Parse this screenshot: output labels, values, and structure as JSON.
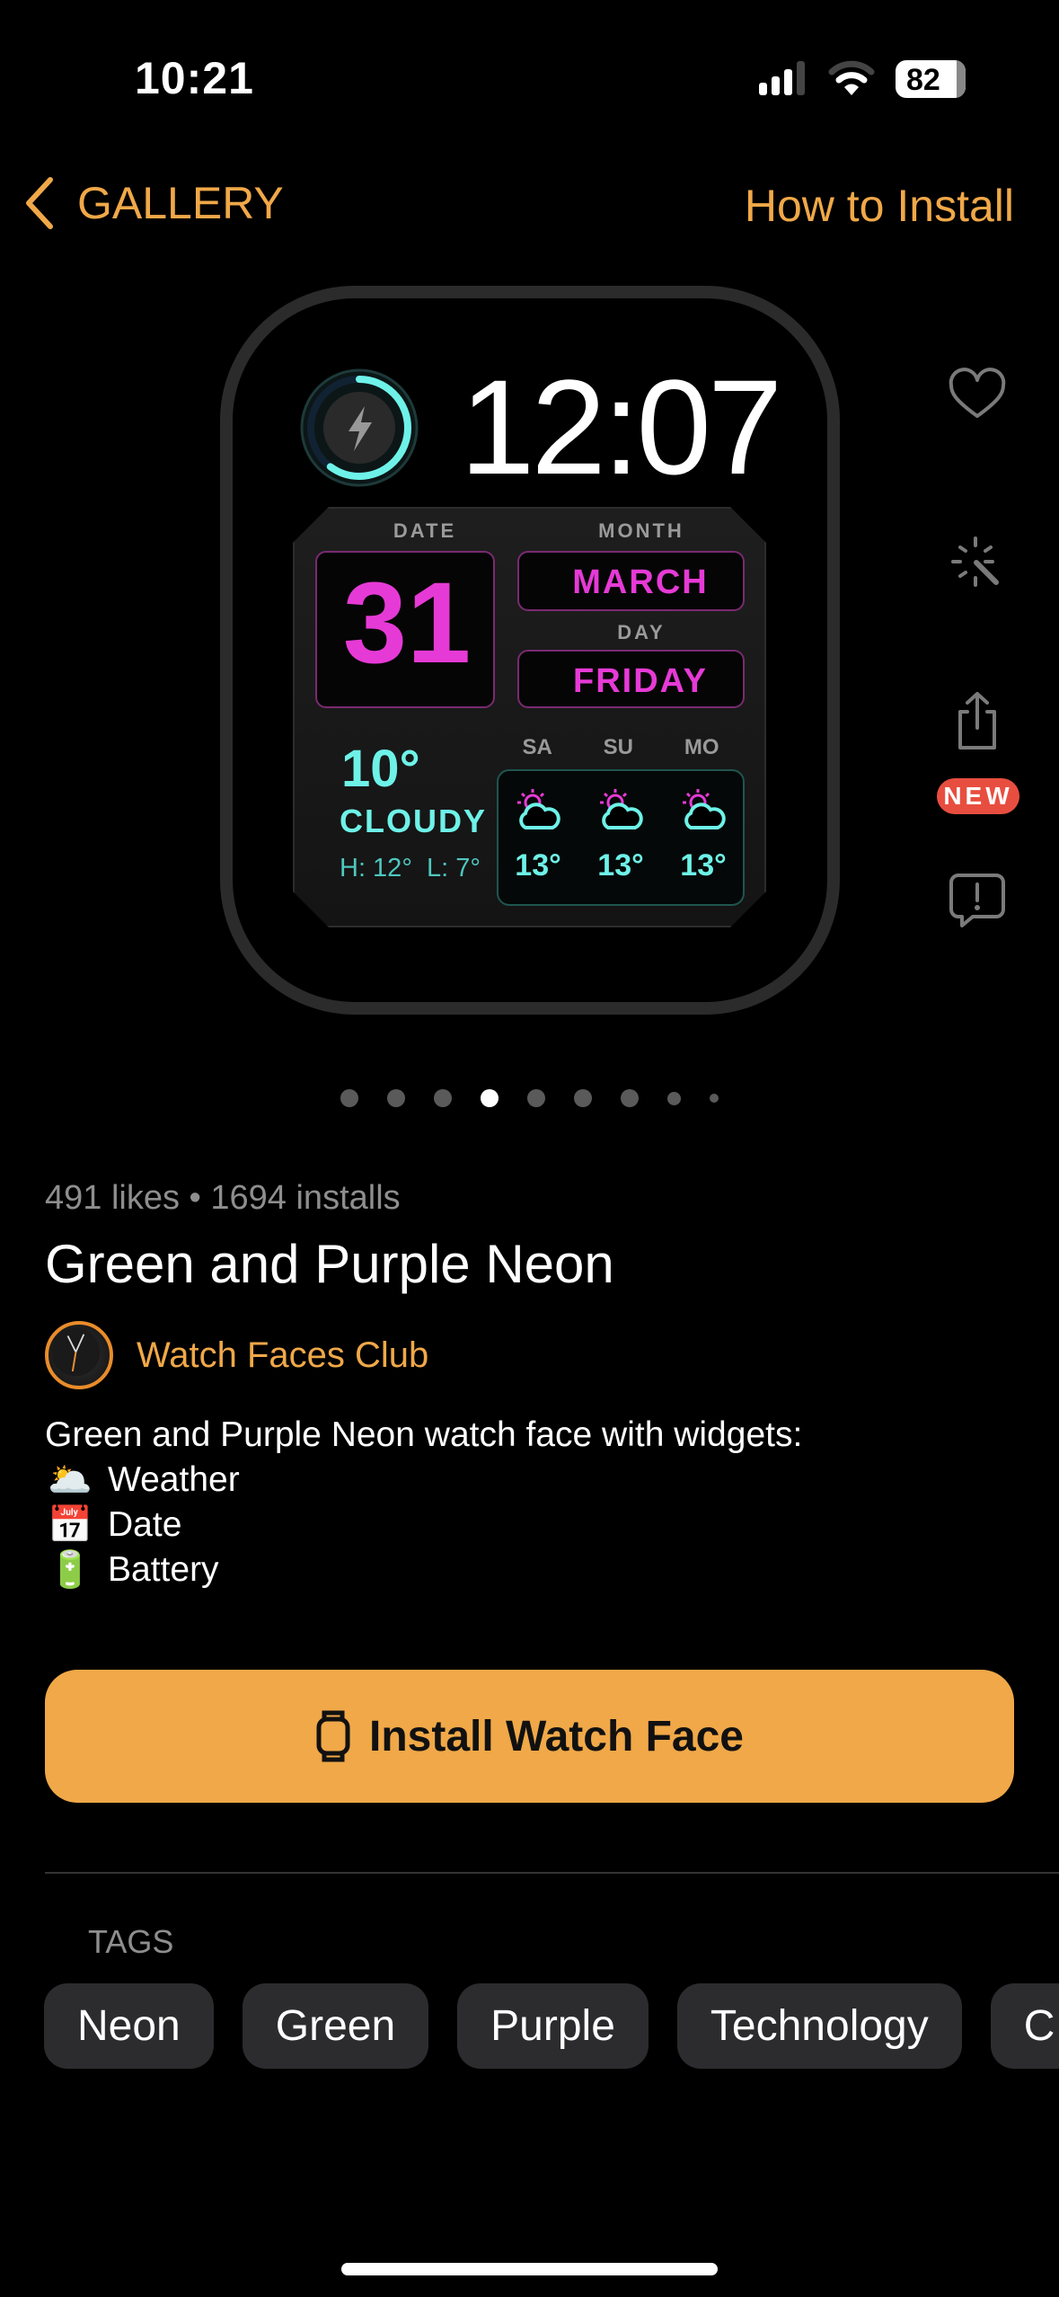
{
  "status_bar": {
    "time": "10:21",
    "battery": "82",
    "signal_bars": 3,
    "wifi_level": 2
  },
  "nav": {
    "back_label": "GALLERY",
    "how_to_install": "How to Install"
  },
  "watch_face": {
    "time": "12:07",
    "battery_level": 0.6,
    "date_label": "DATE",
    "date": "31",
    "month_label": "MONTH",
    "month": "MARCH",
    "day_label": "DAY",
    "day": "FRIDAY",
    "temperature": "10°",
    "condition": "CLOUDY",
    "high_low": "H: 12°  L: 7°",
    "forecast": [
      {
        "day": "SA",
        "temp": "13°"
      },
      {
        "day": "SU",
        "temp": "13°"
      },
      {
        "day": "MO",
        "temp": "13°"
      }
    ],
    "colors": {
      "magenta": "#e63ad6",
      "cyan": "#6ef2e8"
    }
  },
  "side_actions": {
    "items": [
      "heart-icon",
      "magic-wand-icon",
      "share-icon",
      "report-icon"
    ],
    "new_badge": "NEW"
  },
  "pagination": {
    "count": 9,
    "active": 4
  },
  "details": {
    "stats": "491 likes • 1694 installs",
    "title": "Green and Purple Neon",
    "author": "Watch Faces Club",
    "description": "Green and Purple Neon watch face with widgets:",
    "widgets": [
      {
        "emoji": "🌥️",
        "label": "Weather"
      },
      {
        "emoji": "📅",
        "label": "Date"
      },
      {
        "emoji": "🔋",
        "label": "Battery"
      }
    ]
  },
  "install_button": "Install Watch Face",
  "tags": {
    "label": "TAGS",
    "items": [
      "Neon",
      "Green",
      "Purple",
      "Technology",
      "C"
    ]
  },
  "accent": "#F0A848"
}
